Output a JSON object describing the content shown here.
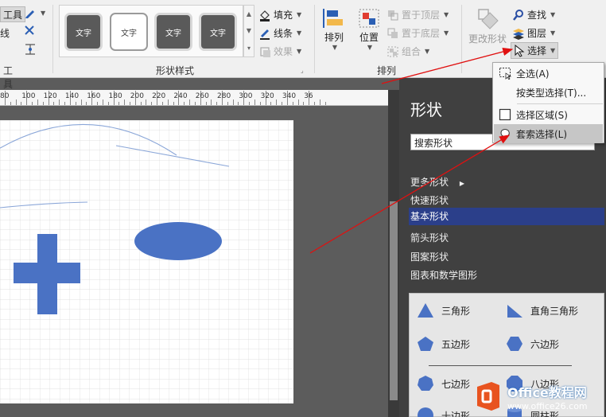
{
  "ribbon": {
    "tools_group": {
      "tool_label_partial": "工具",
      "tool_btn_partial": "工具",
      "line_partial": "线"
    },
    "shape_styles": {
      "label": "形状样式",
      "tiles": [
        "文字",
        "文字",
        "文字",
        "文字"
      ],
      "fill": "填充",
      "line": "线条",
      "effect": "效果"
    },
    "arrange": {
      "label": "排列",
      "arrange_btn": "排列",
      "position_btn": "位置",
      "bring_front": "置于顶层",
      "send_back": "置于底层",
      "group": "组合"
    },
    "editing": {
      "change_shape": "更改形状",
      "find": "查找",
      "layers": "图层",
      "select": "选择"
    }
  },
  "select_menu": {
    "items": [
      {
        "label": "全选(A)",
        "icon": "select-all-icon"
      },
      {
        "label": "按类型选择(T)...",
        "icon": ""
      },
      {
        "label": "选择区域(S)",
        "icon": "area-select-icon"
      },
      {
        "label": "套索选择(L)",
        "icon": "lasso-select-icon",
        "hover": true
      }
    ]
  },
  "ruler": {
    "labels": [
      "80",
      "100",
      "120",
      "140",
      "160",
      "180",
      "200",
      "220",
      "240",
      "260",
      "280",
      "300",
      "320",
      "340",
      "36"
    ]
  },
  "shapes_pane": {
    "title": "形状",
    "search_placeholder": "搜索形状",
    "stencils": [
      "更多形状",
      "快速形状",
      "基本形状",
      "箭头形状",
      "图案形状",
      "图表和数学图形"
    ],
    "active_stencil": "基本形状",
    "shapes": [
      {
        "label": "三角形",
        "icon": "triangle-icon"
      },
      {
        "label": "直角三角形",
        "icon": "right-triangle-icon"
      },
      {
        "label": "五边形",
        "icon": "pentagon-icon"
      },
      {
        "label": "六边形",
        "icon": "hexagon-icon"
      },
      {
        "label": "七边形",
        "icon": "heptagon-icon"
      },
      {
        "label": "八边形",
        "icon": "octagon-icon"
      },
      {
        "label": "十边形",
        "icon": "decagon-icon"
      },
      {
        "label": "圆柱形",
        "icon": "cylinder-icon"
      }
    ]
  },
  "watermark": {
    "brand": "Office教程网",
    "url": "www.office26.com"
  },
  "colors": {
    "shape_fill": "#4a72c4",
    "pane_bg": "#404040",
    "active_stencil": "#2b3f8a",
    "annotation_arrow": "#e01010"
  }
}
